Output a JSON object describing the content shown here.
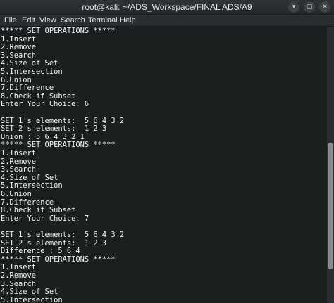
{
  "window": {
    "title": "root@kali: ~/ADS_Workspace/FINAL ADS/A9",
    "buttons": {
      "minimize": "▾",
      "maximize": "▢",
      "close": "✕"
    }
  },
  "menu": [
    "File",
    "Edit",
    "View",
    "Search",
    "Terminal",
    "Help"
  ],
  "terminal": {
    "lines": [
      "***** SET OPERATIONS *****",
      "1.Insert",
      "2.Remove",
      "3.Search",
      "4.Size of Set",
      "5.Intersection",
      "6.Union",
      "7.Difference",
      "8.Check if Subset",
      "Enter Your Choice: 6",
      "",
      "SET 1's elements:  5 6 4 3 2",
      "SET 2's elements:  1 2 3",
      "Union : 5 6 4 3 2 1",
      "***** SET OPERATIONS *****",
      "1.Insert",
      "2.Remove",
      "3.Search",
      "4.Size of Set",
      "5.Intersection",
      "6.Union",
      "7.Difference",
      "8.Check if Subset",
      "Enter Your Choice: 7",
      "",
      "SET 1's elements:  5 6 4 3 2",
      "SET 2's elements:  1 2 3",
      "Difference : 5 6 4",
      "***** SET OPERATIONS *****",
      "1.Insert",
      "2.Remove",
      "3.Search",
      "4.Size of Set",
      "5.Intersection"
    ]
  }
}
